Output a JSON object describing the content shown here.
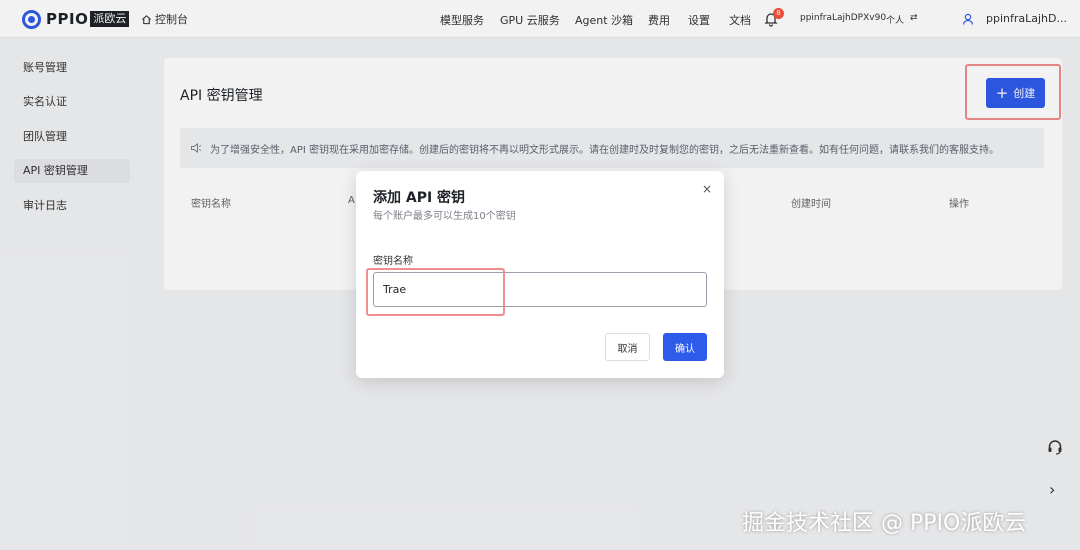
{
  "brand": {
    "name": "PPIO",
    "badge": "派欧云",
    "accent": "#2f5bea"
  },
  "topnav": {
    "console": "控制台",
    "items": [
      "模型服务",
      "GPU 云服务",
      "Agent 沙箱",
      "费用",
      "设置",
      "文档"
    ],
    "notification_count": "8",
    "account_name": "ppinfraLajhDPXv90",
    "account_type": "个人",
    "switch_glyph": "⇄",
    "user_name": "ppinfraLajhD..."
  },
  "sidebar": {
    "items": [
      {
        "label": "账号管理"
      },
      {
        "label": "实名认证"
      },
      {
        "label": "团队管理"
      },
      {
        "label": "API 密钥管理",
        "active": true
      },
      {
        "label": "审计日志"
      }
    ]
  },
  "main": {
    "title": "API 密钥管理",
    "create_label": "创建",
    "notice": "为了增强安全性，API 密钥现在采用加密存储。创建后的密钥将不再以明文形式展示。请在创建时及时复制您的密钥，之后无法重新查看。如有任何问题，请联系我们的客服支持。",
    "table_headers": [
      "密钥名称",
      "A",
      "创建时间",
      "操作"
    ]
  },
  "modal": {
    "title": "添加 API 密钥",
    "subtitle": "每个账户最多可以生成10个密钥",
    "field_label": "密钥名称",
    "field_value": "Trae",
    "cancel_label": "取消",
    "confirm_label": "确认",
    "close_glyph": "×"
  },
  "floating": {
    "arrow_glyph": "›"
  },
  "watermark": "掘金技术社区 @ PPIO派欧云",
  "colors": {
    "primary": "#2f5bea",
    "highlight": "#f08d8d",
    "badge": "#f5533d"
  }
}
